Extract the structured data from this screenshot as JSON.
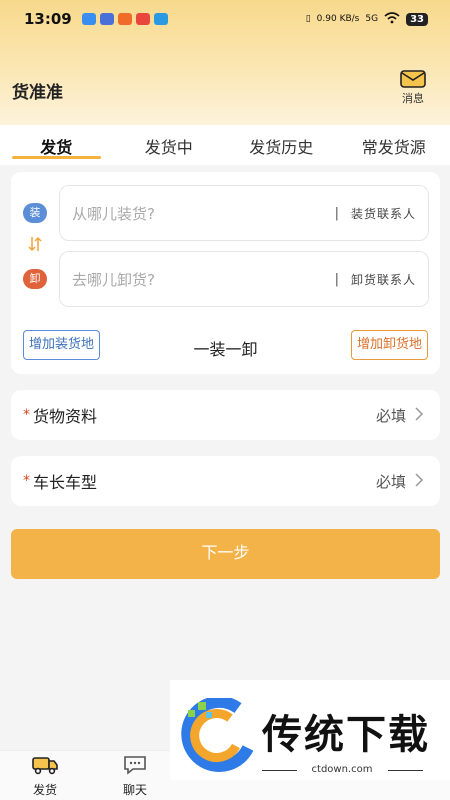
{
  "status_bar": {
    "time": "13:09",
    "net_speed": "0.90 KB/s",
    "signal": "5G",
    "battery": "33"
  },
  "header": {
    "title": "货准准",
    "message_label": "消息",
    "message_icon": "envelope-icon"
  },
  "tabs": [
    {
      "label": "发货",
      "active": true
    },
    {
      "label": "发货中",
      "active": false
    },
    {
      "label": "发货历史",
      "active": false
    },
    {
      "label": "常发货源",
      "active": false
    }
  ],
  "route": {
    "load_badge": "装",
    "unload_badge": "卸",
    "load_placeholder": "从哪儿装货?",
    "unload_placeholder": "去哪儿卸货?",
    "separator": "|",
    "load_contact": "装货联系人",
    "unload_contact": "卸货联系人",
    "swap_icon": "swap-arrows-icon",
    "add_load_label": "增加装货地",
    "add_unload_label": "增加卸货地",
    "mode_label": "一装一卸"
  },
  "fields": {
    "goods": {
      "required_mark": "*",
      "label": "货物资料",
      "value": "必填"
    },
    "truck": {
      "required_mark": "*",
      "label": "车长车型",
      "value": "必填"
    }
  },
  "next_button": "下一步",
  "bottom_nav": [
    {
      "label": "发货",
      "icon": "truck-icon"
    },
    {
      "label": "聊天",
      "icon": "chat-icon"
    }
  ],
  "watermark": {
    "text": "传统下载",
    "url": "ctdown.com"
  },
  "colors": {
    "accent": "#f4b348",
    "load_blue": "#5b8ed6",
    "unload_orange": "#e0623a"
  }
}
